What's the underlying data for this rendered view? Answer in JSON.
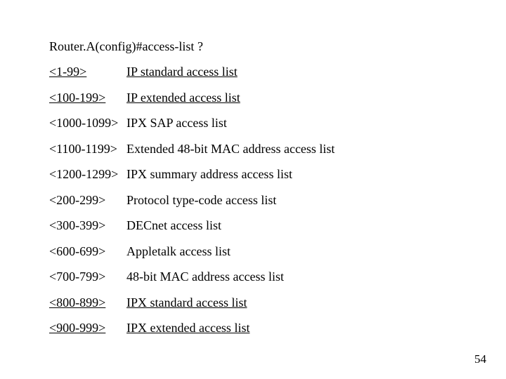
{
  "prompt": "Router.A(config)#access-list ?",
  "rows": [
    {
      "range": "<1-99>",
      "desc": "IP standard access list",
      "underline": true
    },
    {
      "range": "<100-199>",
      "desc": "IP extended access list",
      "underline": true
    },
    {
      "range": "<1000-1099>",
      "desc": "IPX SAP access list",
      "underline": false
    },
    {
      "range": "<1100-1199>",
      "desc": "Extended 48-bit MAC address access list",
      "underline": false
    },
    {
      "range": "<1200-1299>",
      "desc": "IPX summary address access list",
      "underline": false
    },
    {
      "range": "<200-299>",
      "desc": "Protocol type-code access list",
      "underline": false
    },
    {
      "range": "<300-399>",
      "desc": "DECnet access list",
      "underline": false
    },
    {
      "range": "<600-699>",
      "desc": "Appletalk access list",
      "underline": false
    },
    {
      "range": "<700-799>",
      "desc": "48-bit MAC address access list",
      "underline": false
    },
    {
      "range": "<800-899>",
      "desc": "IPX standard access list",
      "underline": true
    },
    {
      "range": "<900-999>",
      "desc": "IPX extended access list",
      "underline": true
    }
  ],
  "page_number": "54"
}
